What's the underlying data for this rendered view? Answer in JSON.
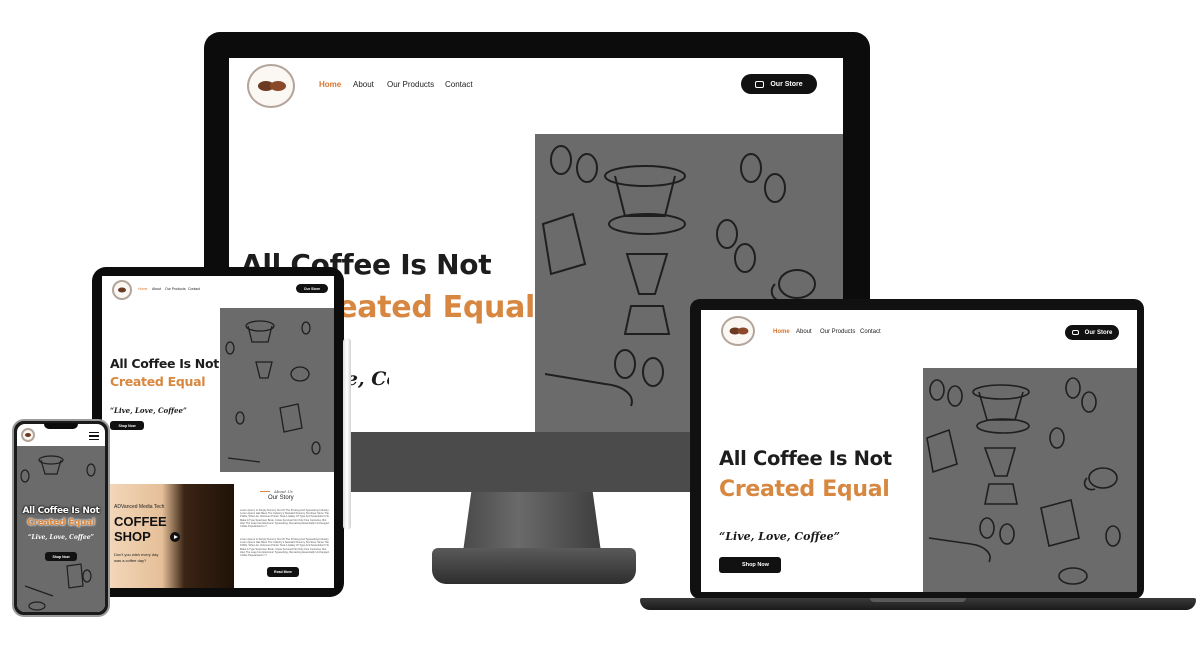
{
  "site": {
    "nav": {
      "home": "Home",
      "about": "About",
      "products": "Our Products",
      "contact": "Contact",
      "store_button": "Our Store"
    },
    "hero": {
      "line1": "All Coffee Is Not",
      "line2": "Created Equal",
      "tagline": "“Live, Love, Coffee”",
      "shop_button": "Shop Now"
    },
    "about": {
      "kicker": "About Us",
      "title": "Our Story",
      "paragraph1": "Lorem Ipsum Is Simply Dummy Text Of The Printing And Typesetting Industry. Lorem Ipsum Has Been The Industry's Standard Dummy Text Ever Since The 1500s, When An Unknown Printer Took A Galley Of Type And Scrambled It To Make A Type Specimen Book. It Has Survived Not Only Five Centuries, But Also The Leap Into Electronic Typesetting, Remaining Essentially Unchanged. It Was Popularised In T",
      "paragraph2": "Lorem Ipsum Is Simply Dummy Text Of The Printing And Typesetting Industry. Lorem Ipsum Has Been The Industry's Standard Dummy Text Ever Since The 1500s, When An Unknown Printer Took A Galley Of Type And Scrambled It To Make A Type Specimen Book. It Has Survived Not Only Five Centuries, But Also The Leap Into Electronic Typesetting, Remaining Essentially Unchanged. It Was Popularised In T",
      "read_more": "Read More",
      "video": {
        "brand": "ADVanced Media Tech",
        "title_line1": "COFFEE",
        "title_line2": "SHOP",
        "caption_line1": "Don't you wish every day",
        "caption_line2": "was a coffee day?"
      }
    },
    "colors": {
      "accent": "#d7873f",
      "dark": "#111111",
      "pattern": "#6b6b6b",
      "active_nav": "#d8772f"
    },
    "icons": [
      "cart-icon",
      "menu-icon",
      "play-icon",
      "logo-bean-icon"
    ]
  }
}
